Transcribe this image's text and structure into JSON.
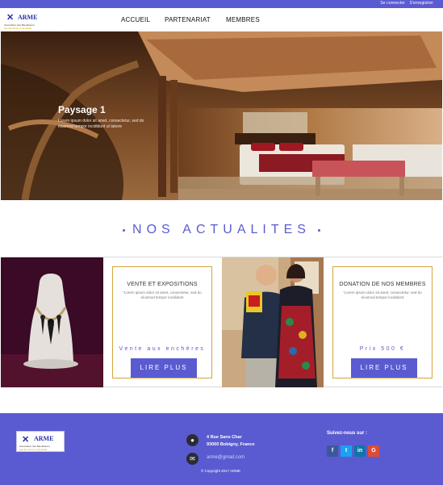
{
  "topbar": {
    "login": "Se connecter",
    "register": "S'enregistrer"
  },
  "logo": {
    "name": "ARME",
    "tagline": "Association des Bienfaiteurs",
    "tagline2": "des Membres en Entraide"
  },
  "nav": {
    "items": [
      "ACCUEIL",
      "PARTENARIAT",
      "MEMBRES"
    ]
  },
  "hero": {
    "title": "Paysage 1",
    "text": "Lorem ipsum dolor sit amet, consectetur, sed do eiusmod tempor incididunt ut labore"
  },
  "news": {
    "title": "NOS ACTUALITES"
  },
  "cards": [
    {
      "title": "VENTE ET EXPOSITIONS",
      "text": "\"Lorem ipsum dolor sit amet, consectetur, sed do eiusmod tempor incididunt",
      "price": "Vente aux enchères",
      "button": "LIRE PLUS"
    },
    {
      "title": "DONATION DE NOS MEMBRES",
      "text": "\"Lorem ipsum dolor sit amet, consectetur, sed do eiusmod tempor incididunt",
      "price": "Prix 500 €",
      "button": "LIRE PLUS"
    }
  ],
  "footer": {
    "address_line1": "4 Rue Sans Char",
    "address_line2": "93000 Bobigny, France",
    "email": "arme@gmail.com",
    "copyright": "© Copyright 2017 ARME",
    "follow": "Suivez-nous sur :",
    "social": [
      {
        "icon": "facebook-icon",
        "glyph": "f",
        "color": "#3b5998"
      },
      {
        "icon": "twitter-icon",
        "glyph": "t",
        "color": "#1da1f2"
      },
      {
        "icon": "linkedin-icon",
        "glyph": "in",
        "color": "#0e76a8"
      },
      {
        "icon": "google-plus-icon",
        "glyph": "G",
        "color": "#dd4b39"
      }
    ]
  },
  "colors": {
    "accent": "#5a5bd0",
    "panel_border": "#d6a43c",
    "dark": "#2b2b35"
  }
}
